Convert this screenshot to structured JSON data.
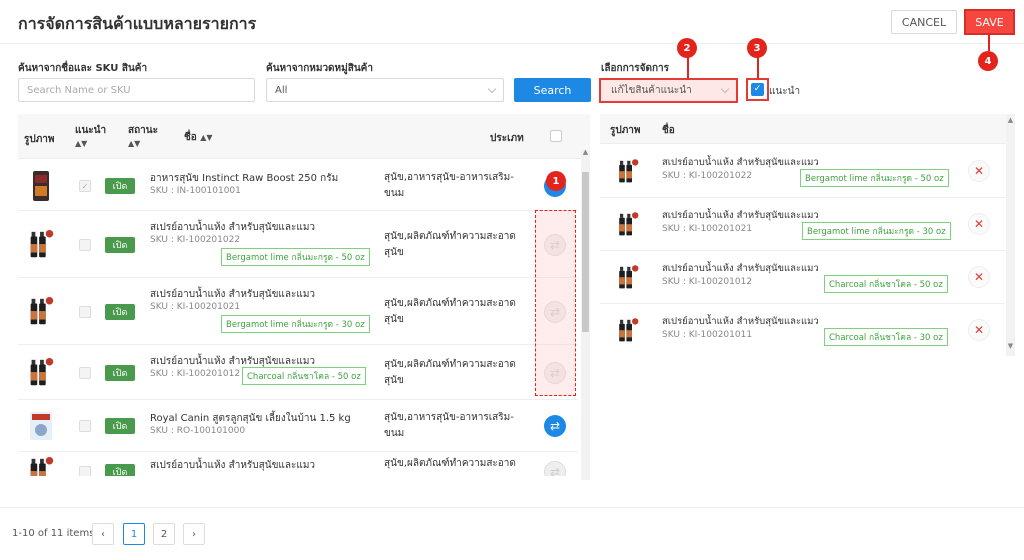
{
  "header": {
    "title": "การจัดการสินค้าแบบหลายรายการ",
    "cancel_label": "CANCEL",
    "save_label": "SAVE"
  },
  "filters": {
    "name_sku_label": "ค้นหาจากชื่อและ SKU สินค้า",
    "name_sku_placeholder": "Search Name or SKU",
    "category_label": "ค้นหาจากหมวดหมู่สินค้า",
    "category_value": "All",
    "search_label": "Search",
    "action_label": "เลือกการจัดการ",
    "action_value": "แก้ไขสินค้าแนะนำ",
    "recommend_checkbox_label": "แนะนำ"
  },
  "badges": [
    "1",
    "2",
    "3",
    "4"
  ],
  "left_table": {
    "headers": {
      "image": "รูปภาพ",
      "recommend": "แนะนำ",
      "status": "สถานะ",
      "name": "ชื่อ",
      "type": "ประเภท"
    },
    "rows": [
      {
        "name": "อาหารสุนัข Instinct Raw Boost 250 กรัม",
        "sku": "SKU : IN-100101001",
        "tag": "",
        "type": "สุนัข,อาหารสุนัข-อาหารเสริม-ขนม",
        "status": "เปิด",
        "checked": true,
        "swap": "on",
        "thumb": "bag-dark"
      },
      {
        "name": "สเปรย์อาบน้ำแห้ง สำหรับสุนัขและแมว",
        "sku": "SKU : KI-100201022",
        "tag": "Bergamot lime กลิ่นมะกรูด - 50 oz",
        "type": "สุนัข,ผลิตภัณฑ์ทำความสะอาดสุนัข",
        "status": "เปิด",
        "checked": false,
        "swap": "off",
        "thumb": "spray"
      },
      {
        "name": "สเปรย์อาบน้ำแห้ง สำหรับสุนัขและแมว",
        "sku": "SKU : KI-100201021",
        "tag": "Bergamot lime กลิ่นมะกรูด - 30 oz",
        "type": "สุนัข,ผลิตภัณฑ์ทำความสะอาดสุนัข",
        "status": "เปิด",
        "checked": false,
        "swap": "off",
        "thumb": "spray"
      },
      {
        "name": "สเปรย์อาบน้ำแห้ง สำหรับสุนัขและแมว",
        "sku": "SKU : KI-100201012",
        "tag": "Charcoal กลิ่นชาโคล - 50 oz",
        "type": "สุนัข,ผลิตภัณฑ์ทำความสะอาดสุนัข",
        "status": "เปิด",
        "checked": false,
        "swap": "off",
        "thumb": "spray"
      },
      {
        "name": "Royal Canin สูตรลูกสุนัข เลี้ยงในบ้าน 1.5 kg",
        "sku": "SKU : RO-100101000",
        "tag": "",
        "type": "สุนัข,อาหารสุนัข-อาหารเสริม-ขนม",
        "status": "เปิด",
        "checked": false,
        "swap": "on",
        "thumb": "bag-blue"
      },
      {
        "name": "สเปรย์อาบน้ำแห้ง สำหรับสุนัขและแมว",
        "sku": "",
        "tag": "",
        "type": "สุนัข,ผลิตภัณฑ์ทำความสะอาด",
        "status": "เปิด",
        "checked": false,
        "swap": "off",
        "thumb": "spray"
      }
    ]
  },
  "right_table": {
    "headers": {
      "image": "รูปภาพ",
      "name": "ชื่อ"
    },
    "rows": [
      {
        "name": "สเปรย์อาบน้ำแห้ง สำหรับสุนัขและแมว",
        "sku": "SKU : KI-100201022",
        "tag": "Bergamot lime กลิ่นมะกรูด - 50 oz"
      },
      {
        "name": "สเปรย์อาบน้ำแห้ง สำหรับสุนัขและแมว",
        "sku": "SKU : KI-100201021",
        "tag": "Bergamot lime กลิ่นมะกรูด - 30 oz"
      },
      {
        "name": "สเปรย์อาบน้ำแห้ง สำหรับสุนัขและแมว",
        "sku": "SKU : KI-100201012",
        "tag": "Charcoal กลิ่นชาโคล - 50 oz"
      },
      {
        "name": "สเปรย์อาบน้ำแห้ง สำหรับสุนัขและแมว",
        "sku": "SKU : KI-100201011",
        "tag": "Charcoal กลิ่นชาโคล - 30 oz"
      }
    ]
  },
  "pagination": {
    "summary": "1-10 of 11 items",
    "pages": [
      "1",
      "2"
    ],
    "current": "1"
  },
  "colors": {
    "primary": "#1e88e5",
    "danger": "#f5473f",
    "status_green": "#4a9a4e",
    "tag_green": "#3ea33e"
  }
}
